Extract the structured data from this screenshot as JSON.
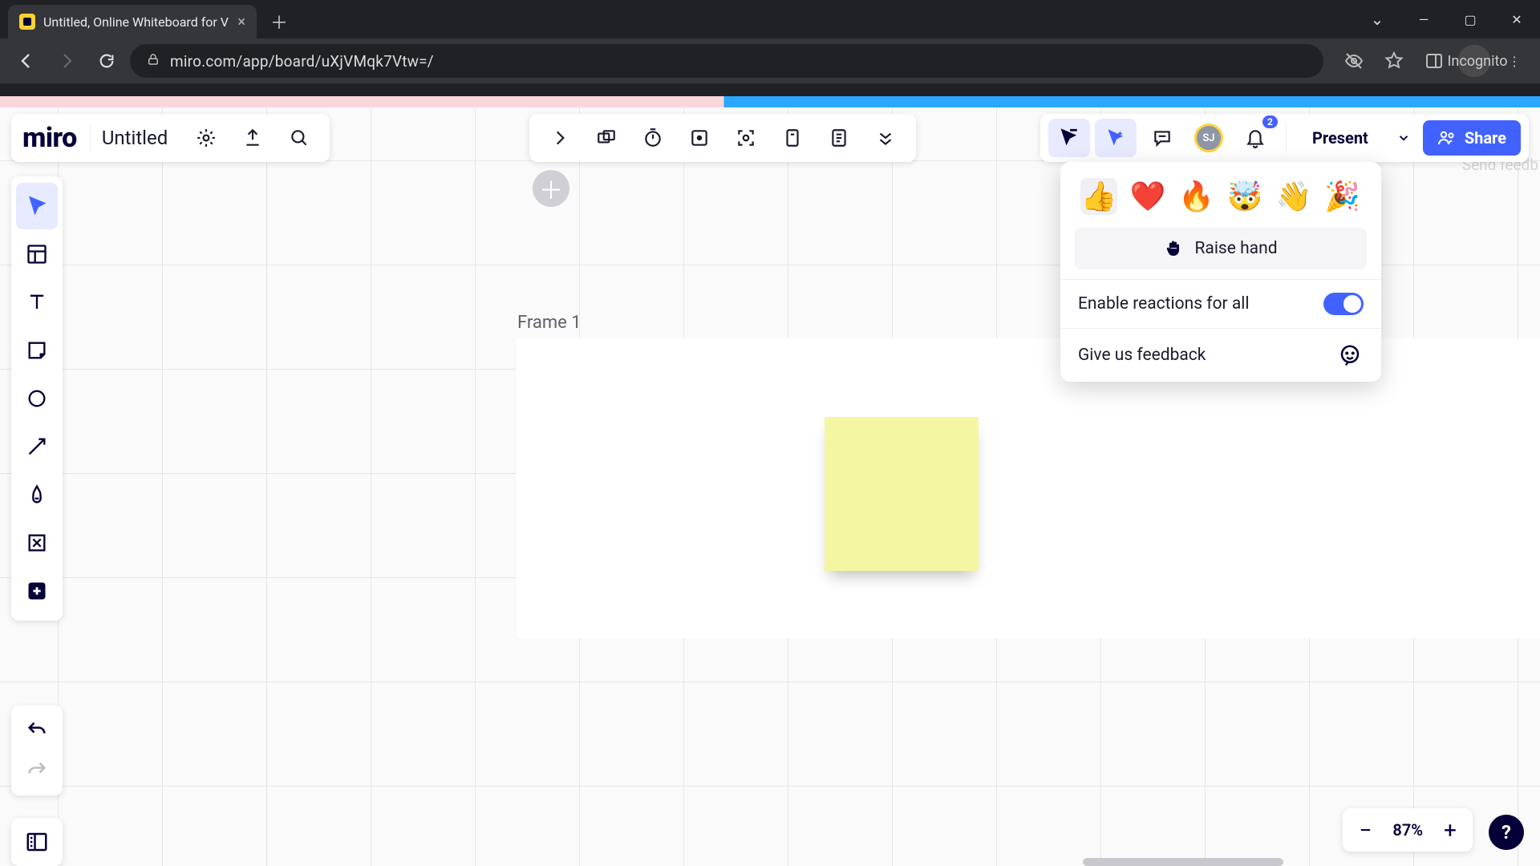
{
  "browser": {
    "tab_title": "Untitled, Online Whiteboard for V",
    "url": "miro.com/app/board/uXjVMqk7Vtw=/",
    "incognito_label": "Incognito"
  },
  "header": {
    "logo_text": "miro",
    "board_title": "Untitled"
  },
  "canvas": {
    "frame_label": "Frame 1"
  },
  "topright": {
    "avatar_initials": "SJ",
    "notification_count": "2",
    "present_label": "Present",
    "share_label": "Share"
  },
  "reactions_panel": {
    "emojis": {
      "thumbs_up": "👍",
      "heart": "❤️",
      "fire": "🔥",
      "mind_blown": "🤯",
      "wave": "👋",
      "party": "🎉"
    },
    "raise_hand_label": "Raise hand",
    "raise_hand_icon": "✋",
    "enable_label": "Enable reactions for all",
    "feedback_label": "Give us feedback"
  },
  "zoom": {
    "value": "87%"
  },
  "ghost": {
    "send_feedback": "Send feedb"
  },
  "help": {
    "label": "?"
  }
}
